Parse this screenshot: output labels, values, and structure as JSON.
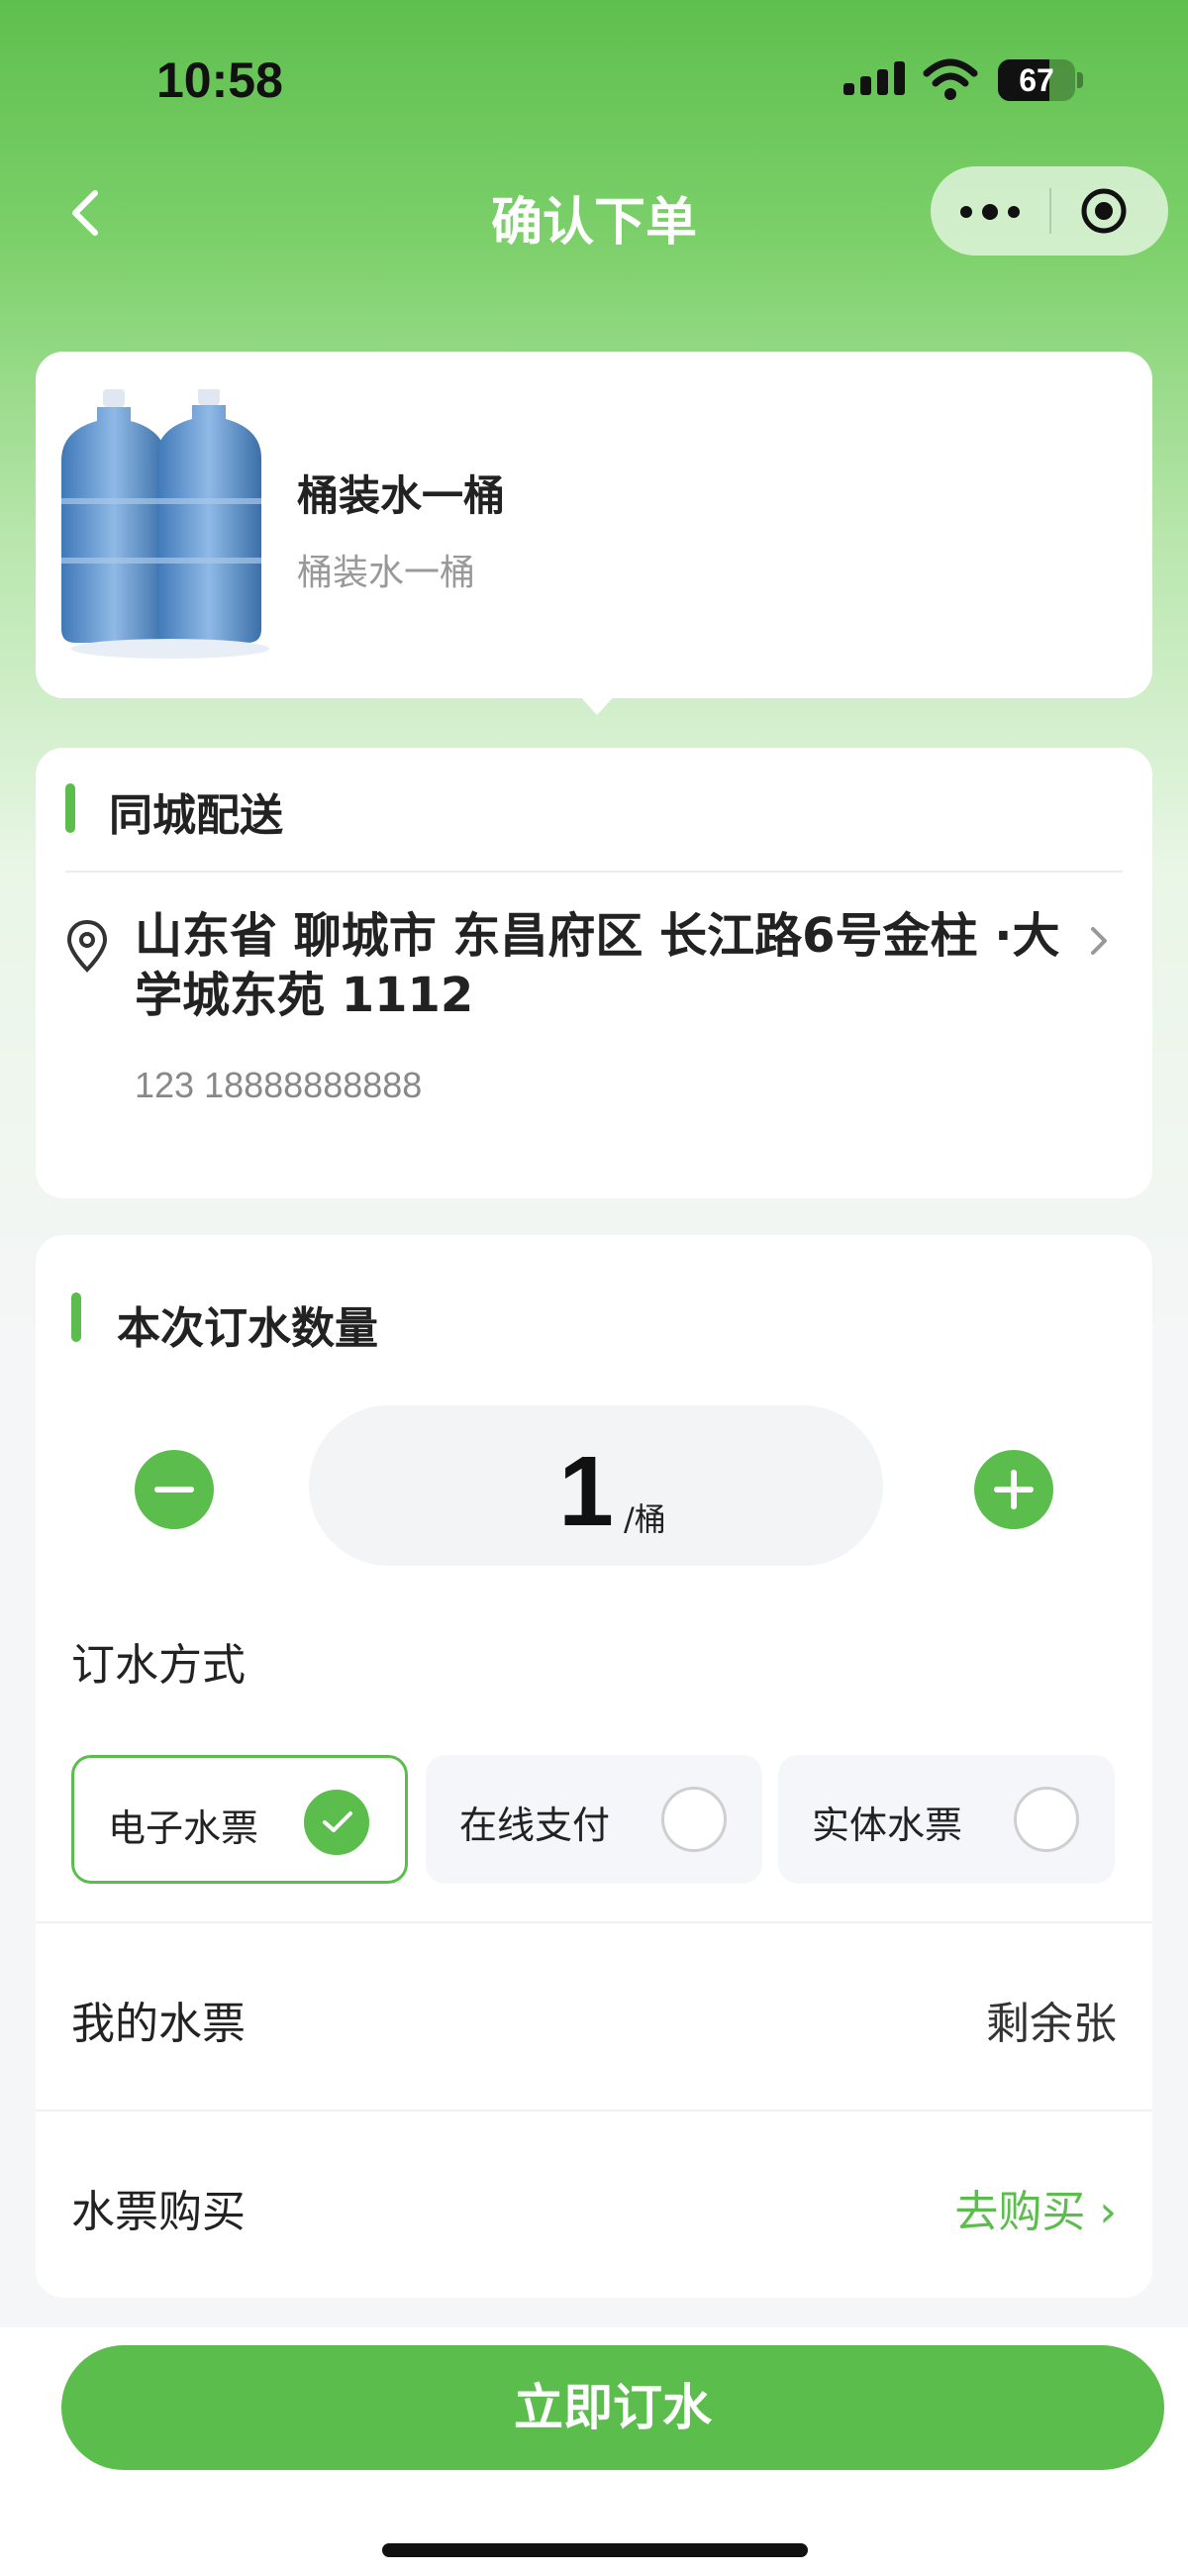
{
  "status_bar": {
    "time": "10:58",
    "battery_level": "67",
    "battery_fraction": 0.67
  },
  "nav": {
    "title": "确认下单",
    "back_icon": "chevron-left-icon",
    "more_icon": "more-dots-icon",
    "close_icon": "target-icon"
  },
  "product": {
    "name": "桶装水一桶",
    "desc": "桶装水一桶",
    "image_icon": "water-bucket-image"
  },
  "delivery": {
    "title": "同城配送",
    "address": "山东省 聊城市 东昌府区 长江路6号金柱 ·大学城东苑 1112",
    "contact": "123 18888888888",
    "location_icon": "location-pin-icon"
  },
  "order": {
    "qty_title": "本次订水数量",
    "quantity": "1",
    "unit": "/桶",
    "method_label": "订水方式",
    "options": [
      {
        "label": "电子水票",
        "selected": true
      },
      {
        "label": "在线支付",
        "selected": false
      },
      {
        "label": "实体水票",
        "selected": false
      }
    ],
    "my_tickets_label": "我的水票",
    "my_tickets_value": "剩余张",
    "purchase_label": "水票购买",
    "purchase_link": "去购买 ›"
  },
  "bottom": {
    "order_button": "立即订水"
  },
  "colors": {
    "accent": "#5bbd4b",
    "header_top": "#5fbf4e"
  }
}
